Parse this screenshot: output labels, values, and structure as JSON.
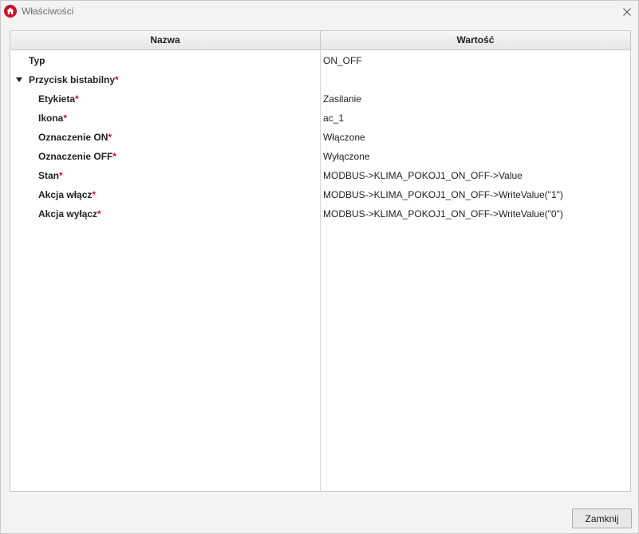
{
  "window": {
    "title": "Właściwości",
    "app_icon": "home-icon",
    "close_icon": "close-icon"
  },
  "table": {
    "columns": [
      "Nazwa",
      "Wartość"
    ],
    "rows": [
      {
        "name": "Typ",
        "required": "",
        "value": "ON_OFF"
      },
      {
        "name": "Przycisk bistabilny",
        "required": "*",
        "value": "",
        "expanded_icon": "triangle-down-icon"
      },
      {
        "name": "Etykieta",
        "required": "*",
        "value": "Zasilanie"
      },
      {
        "name": "Ikona",
        "required": "*",
        "value": "ac_1"
      },
      {
        "name": "Oznaczenie ON",
        "required": "*",
        "value": "Włączone"
      },
      {
        "name": "Oznaczenie OFF",
        "required": "*",
        "value": "Wyłączone"
      },
      {
        "name": "Stan",
        "required": "*",
        "value": "MODBUS->KLIMA_POKOJ1_ON_OFF->Value"
      },
      {
        "name": "Akcja włącz",
        "required": "*",
        "value": "MODBUS->KLIMA_POKOJ1_ON_OFF->WriteValue(\"1\")"
      },
      {
        "name": "Akcja wyłącz",
        "required": "*",
        "value": "MODBUS->KLIMA_POKOJ1_ON_OFF->WriteValue(\"0\")"
      }
    ]
  },
  "footer": {
    "close_label": "Zamknij"
  },
  "colors": {
    "accent": "#c8102e",
    "required_marker": "#c8102e"
  }
}
